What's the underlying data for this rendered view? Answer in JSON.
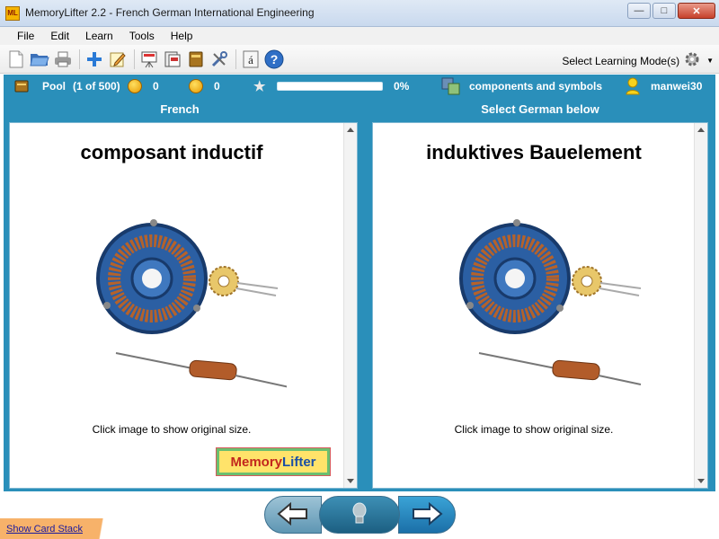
{
  "window": {
    "title": "MemoryLifter 2.2 - French German International Engineering",
    "app_icon_text": "ML"
  },
  "menu": {
    "items": [
      "File",
      "Edit",
      "Learn",
      "Tools",
      "Help"
    ]
  },
  "toolbar": {
    "learning_mode_label": "Select Learning Mode(s)"
  },
  "status": {
    "pool_label": "Pool",
    "pool_count": "(1 of 500)",
    "happy_count": "0",
    "sad_count": "0",
    "progress_value": 0,
    "progress_text": "0%",
    "chapter": "components and symbols",
    "user": "manwei30"
  },
  "left_panel": {
    "header": "French",
    "word": "composant inductif",
    "caption": "Click image to show original size.",
    "logo_text_a": "Memory",
    "logo_text_b": "Lifter"
  },
  "right_panel": {
    "header": "Select German below",
    "word": "induktives Bauelement",
    "caption": "Click image to show original size."
  },
  "footer": {
    "show_card_stack": "Show Card Stack"
  },
  "colors": {
    "accent": "#2a8fba",
    "link": "#1a1a9e"
  },
  "icons": [
    "new-icon",
    "open-icon",
    "print-icon",
    "add-icon",
    "edit-icon",
    "presentation-icon",
    "card-icon",
    "book-icon",
    "settings-icon",
    "accent-char-icon",
    "help-icon",
    "gear-icon"
  ]
}
